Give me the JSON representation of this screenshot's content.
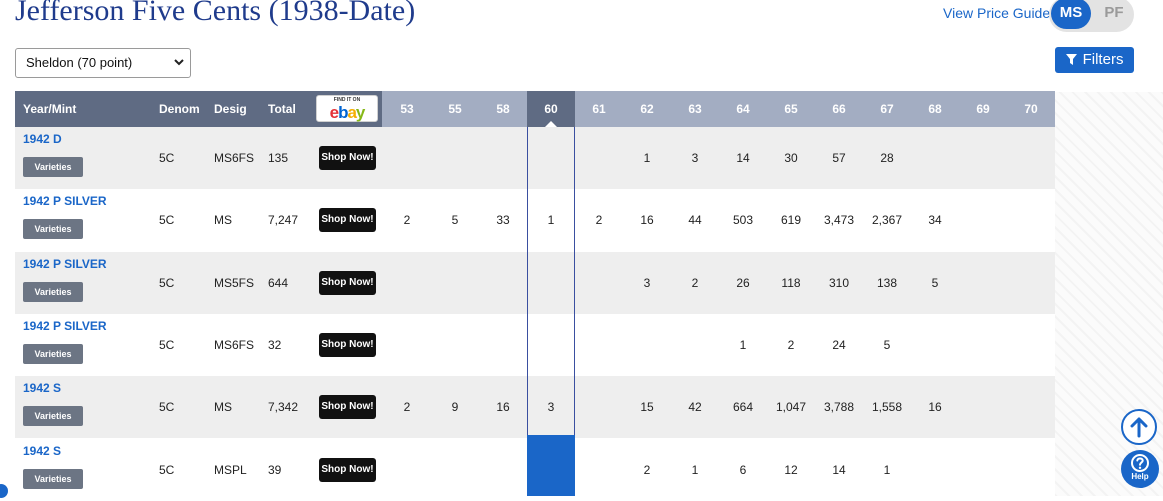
{
  "page": {
    "title": "Jefferson Five Cents (1938-Date)",
    "view_price_guide": "View Price Guide",
    "toggle": {
      "ms": "MS",
      "pf": "PF",
      "selected": "MS"
    },
    "grading_select": {
      "value": "Sheldon (70 point)"
    },
    "filters_label": "Filters"
  },
  "table": {
    "headers": {
      "year_mint": "Year/Mint",
      "denom": "Denom",
      "desig": "Desig",
      "total": "Total",
      "ebay_find": "FIND IT ON",
      "ebay_word": "ebay"
    },
    "grades": [
      "53",
      "55",
      "58",
      "60",
      "61",
      "62",
      "63",
      "64",
      "65",
      "66",
      "67",
      "68",
      "69",
      "70"
    ],
    "highlighted_grade": "60",
    "varieties_label": "Varieties",
    "shop_label": "Shop Now!",
    "rows": [
      {
        "name": "1942 D",
        "denom": "5C",
        "desig": "MS6FS",
        "total": "135",
        "values": [
          "",
          "",
          "",
          "",
          "",
          "1",
          "3",
          "14",
          "30",
          "57",
          "28",
          "",
          "",
          ""
        ]
      },
      {
        "name": "1942 P SILVER",
        "denom": "5C",
        "desig": "MS",
        "total": "7,247",
        "values": [
          "2",
          "5",
          "33",
          "1",
          "2",
          "16",
          "44",
          "503",
          "619",
          "3,473",
          "2,367",
          "34",
          "",
          ""
        ]
      },
      {
        "name": "1942 P SILVER",
        "denom": "5C",
        "desig": "MS5FS",
        "total": "644",
        "values": [
          "",
          "",
          "",
          "",
          "",
          "3",
          "2",
          "26",
          "118",
          "310",
          "138",
          "5",
          "",
          ""
        ]
      },
      {
        "name": "1942 P SILVER",
        "denom": "5C",
        "desig": "MS6FS",
        "total": "32",
        "values": [
          "",
          "",
          "",
          "",
          "",
          "",
          "",
          "1",
          "2",
          "24",
          "5",
          "",
          "",
          ""
        ]
      },
      {
        "name": "1942 S",
        "denom": "5C",
        "desig": "MS",
        "total": "7,342",
        "values": [
          "2",
          "9",
          "16",
          "3",
          "",
          "15",
          "42",
          "664",
          "1,047",
          "3,788",
          "1,558",
          "16",
          "",
          ""
        ]
      },
      {
        "name": "1942 S",
        "denom": "5C",
        "desig": "MSPL",
        "total": "39",
        "values": [
          "",
          "",
          "",
          "",
          "",
          "2",
          "1",
          "6",
          "12",
          "14",
          "1",
          "",
          "",
          ""
        ]
      }
    ]
  },
  "widgets": {
    "help_label": "Help"
  },
  "colors": {
    "brand_blue": "#1a66c8",
    "title_blue": "#1f3b8c",
    "header_dark": "#5f6b83",
    "header_light": "#a3adc2"
  },
  "icons": {
    "scroll_up": "arrow-up-circle-icon",
    "help": "question-circle-icon",
    "filters": "funnel-icon",
    "select": "chevron-down-icon"
  }
}
